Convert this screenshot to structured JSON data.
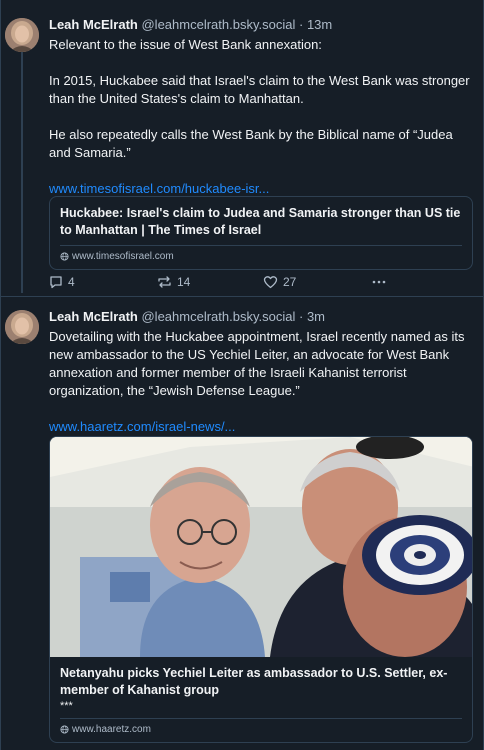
{
  "posts": [
    {
      "author_name": "Leah McElrath",
      "author_handle": "@leahmcelrath.bsky.social",
      "separator": "·",
      "time": "13m",
      "paragraphs": [
        "Relevant to the issue of West Bank annexation:",
        "In 2015, Huckabee said that Israel's claim to the West Bank was stronger than the United States's claim to Manhattan.",
        "He also repeatedly calls the West Bank by the Biblical name of “Judea and Samaria.”"
      ],
      "link_text": "www.timesofisrael.com/huckabee-isr...",
      "card": {
        "title": "Huckabee: Israel's claim to Judea and Samaria stronger than US tie to Manhattan | The Times of Israel",
        "domain": "www.timesofisrael.com"
      },
      "actions": {
        "replies": "4",
        "reposts": "14",
        "likes": "27",
        "more_icon": "ellipsis-icon"
      }
    },
    {
      "author_name": "Leah McElrath",
      "author_handle": "@leahmcelrath.bsky.social",
      "separator": "·",
      "time": "3m",
      "paragraphs": [
        "Dovetailing with the Huckabee appointment, Israel recently named as its new ambassador to the US Yechiel Leiter, an advocate for West Bank annexation and former member of the Israeli Kahanist terrorist organization, the “Jewish Defense League.”"
      ],
      "link_text": "www.haaretz.com/israel-news/...",
      "card": {
        "title": "Netanyahu picks Yechiel Leiter as ambassador to U.S. Settler, ex-member of Kahanist group",
        "extra": "***",
        "domain": "www.haaretz.com"
      }
    }
  ],
  "colors": {
    "background": "#161e27",
    "border": "#2e4052",
    "link": "#208bfe",
    "muted": "#aebbc9"
  }
}
